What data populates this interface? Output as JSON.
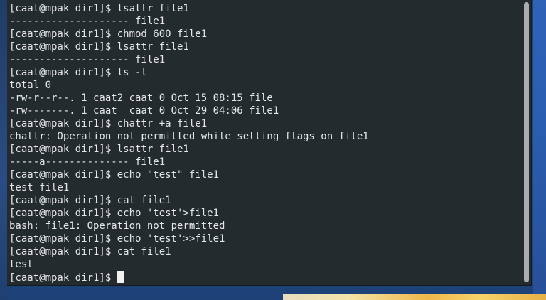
{
  "terminal": {
    "lines": [
      "[caat@mpak dir1]$ lsattr file1",
      "-------------------- file1",
      "[caat@mpak dir1]$ chmod 600 file1",
      "[caat@mpak dir1]$ lsattr file1",
      "-------------------- file1",
      "[caat@mpak dir1]$ ls -l",
      "total 0",
      "-rw-r--r--. 1 caat2 caat 0 Oct 15 08:15 file",
      "-rw-------. 1 caat  caat 0 Oct 29 04:06 file1",
      "[caat@mpak dir1]$ chattr +a file1",
      "chattr: Operation not permitted while setting flags on file1",
      "[caat@mpak dir1]$ lsattr file1",
      "-----a-------------- file1",
      "[caat@mpak dir1]$ echo \"test\" file1",
      "test file1",
      "[caat@mpak dir1]$ cat file1",
      "[caat@mpak dir1]$ echo 'test'>file1",
      "bash: file1: Operation not permitted",
      "[caat@mpak dir1]$ echo 'test'>>file1",
      "[caat@mpak dir1]$ cat file1",
      "test"
    ],
    "prompt": "[caat@mpak dir1]$ "
  },
  "colors": {
    "terminal_background": "#242b2f",
    "terminal_foreground": "#e6e6e6",
    "desktop_background": "#214a86"
  }
}
